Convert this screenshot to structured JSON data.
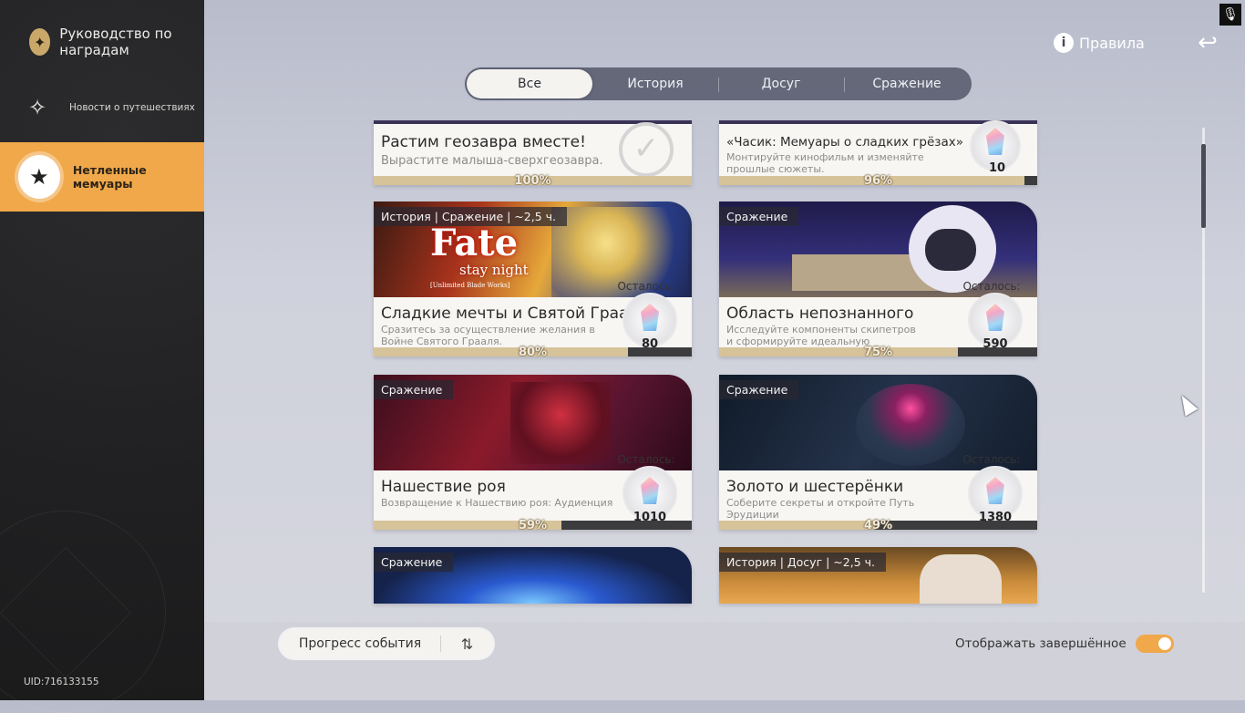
{
  "sidebar": {
    "title": "Руководство по наградам",
    "title_icon": "compass-star-icon",
    "items": [
      {
        "label": "Новости о путешествиях",
        "icon": "signpost-icon"
      },
      {
        "label": "Нетленные мемуары",
        "icon": "star-book-icon"
      }
    ],
    "uid": "UID:716133155"
  },
  "header": {
    "rules_label": "Правила",
    "back_icon": "return-arrow-icon",
    "mic_icon": "microphone-icon"
  },
  "tabs": [
    "Все",
    "История",
    "Досуг",
    "Сражение"
  ],
  "cards": [
    {
      "title": "Растим геозавра вместе!",
      "desc": "Вырастите малыша-сверхгеозавра.",
      "pct_label": "100%",
      "progress": 1.0,
      "completed": true
    },
    {
      "title": "«Часик: Мемуары о сладких грёзах»",
      "desc": "Монтируйте кинофильм и изменяйте прошлые сюжеты.",
      "pct_label": "96%",
      "progress": 0.96,
      "reward": "10"
    },
    {
      "tags": "История | Сражение | ~2,5 ч.",
      "banner_text": "Fate",
      "banner_sub": "stay night",
      "banner_sub2": "[Unlimited Blade Works]",
      "remaining_label": "Осталось:",
      "title": "Сладкие мечты и Святой Грааль",
      "desc": "Сразитесь за осуществление желания в Войне Святого Грааля.",
      "pct_label": "80%",
      "progress": 0.8,
      "reward": "80"
    },
    {
      "tags": "Сражение",
      "remaining_label": "Осталось:",
      "title": "Область непознанного",
      "desc": "Исследуйте компоненты скипетров и сформируйте идеальную команду",
      "pct_label": "75%",
      "progress": 0.75,
      "reward": "590"
    },
    {
      "tags": "Сражение",
      "remaining_label": "Осталось:",
      "title": "Нашествие роя",
      "desc": "Возвращение к Нашествию роя: Аудиенция",
      "pct_label": "59%",
      "progress": 0.59,
      "reward": "1010"
    },
    {
      "tags": "Сражение",
      "remaining_label": "Осталось:",
      "title": "Золото и шестерёнки",
      "desc": "Соберите секреты и откройте Путь Эрудиции",
      "pct_label": "49%",
      "progress": 0.49,
      "reward": "1380"
    },
    {
      "tags": "Сражение"
    },
    {
      "tags": "История | Досуг | ~2,5 ч."
    }
  ],
  "footer": {
    "sort_label": "Прогресс события",
    "sort_icon": "sort-arrows-icon",
    "show_completed_label": "Отображать завершённое",
    "show_completed": true
  },
  "colors": {
    "accent": "#f0a84a",
    "progress_fill": "#d7c39a",
    "progress_track": "#3c3c3f"
  }
}
